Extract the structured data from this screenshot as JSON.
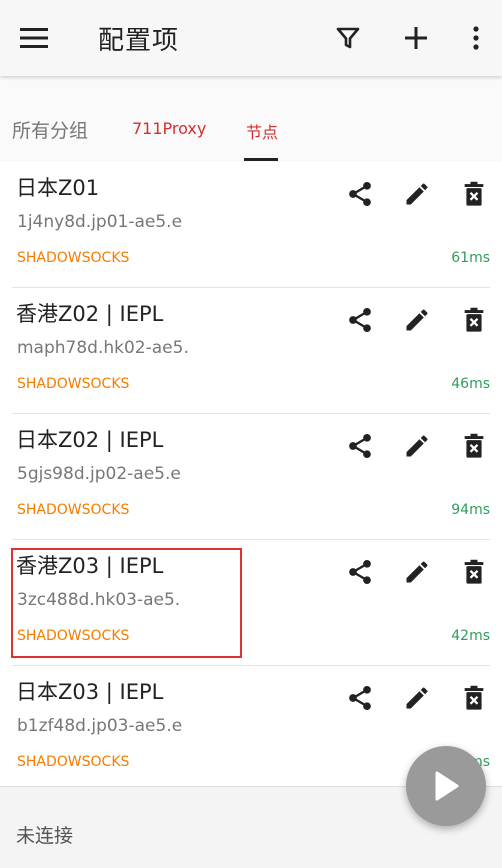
{
  "appbar": {
    "title": "配置项",
    "icons": [
      "menu-icon",
      "filter-icon",
      "add-icon",
      "more-vert-icon"
    ]
  },
  "tabs": [
    {
      "label": "所有分组"
    },
    {
      "label": "711Proxy"
    },
    {
      "label": "节点"
    }
  ],
  "servers": [
    {
      "name": "日本Z01",
      "address": "1j4ny8d.jp01-ae5.e",
      "protocol": "SHADOWSOCKS",
      "latency": "61ms"
    },
    {
      "name": "香港Z02 | IEPL",
      "address": "maph78d.hk02-ae5.",
      "protocol": "SHADOWSOCKS",
      "latency": "46ms"
    },
    {
      "name": "日本Z02 | IEPL",
      "address": "5gjs98d.jp02-ae5.e",
      "protocol": "SHADOWSOCKS",
      "latency": "94ms"
    },
    {
      "name": "香港Z03 | IEPL",
      "address": "3zc488d.hk03-ae5.",
      "protocol": "SHADOWSOCKS",
      "latency": "42ms"
    },
    {
      "name": "日本Z03 | IEPL",
      "address": "b1zf48d.jp03-ae5.e",
      "protocol": "SHADOWSOCKS",
      "latency": "ms"
    }
  ],
  "status": {
    "text": "未连接"
  },
  "colors": {
    "protocol": "#f57c00",
    "latency": "#2e9e5b",
    "highlight": "#e03131",
    "tab_accent": "#d32f2f"
  }
}
